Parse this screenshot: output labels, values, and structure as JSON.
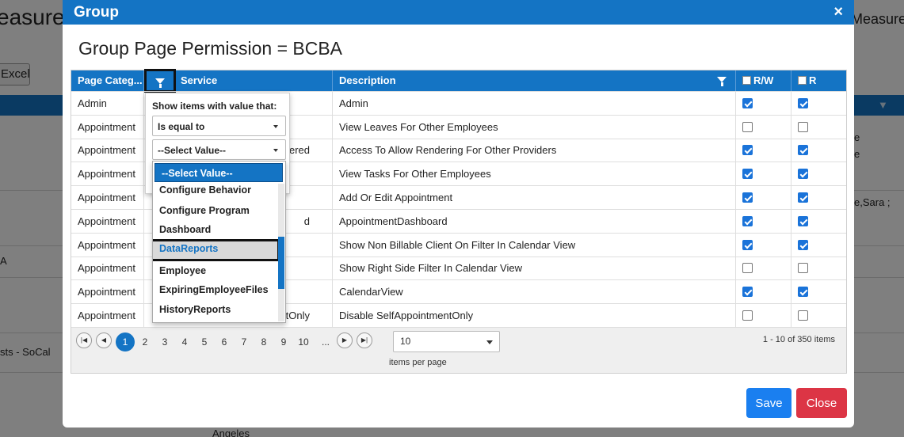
{
  "background": {
    "title_left": "easure",
    "title_right": "Measure",
    "excel_button": "Excel",
    "texts": [
      "A",
      "sts - SoCal",
      "e",
      "e",
      "e,Sara ;",
      "Angeles"
    ]
  },
  "modal": {
    "title": "Group",
    "close_icon": "×",
    "heading": "Group Page Permission = BCBA",
    "save_label": "Save",
    "close_label": "Close"
  },
  "grid": {
    "columns": {
      "category": "Page Categ...",
      "service": "Service",
      "description": "Description",
      "rw": "R/W",
      "r": "R"
    },
    "rows": [
      {
        "category": "Admin",
        "service": "",
        "description": "Admin",
        "rw": true,
        "r": true
      },
      {
        "category": "Appointment",
        "service": "",
        "description": "View Leaves For Other Employees",
        "rw": false,
        "r": false
      },
      {
        "category": "Appointment",
        "service": "ered",
        "description": "Access To Allow Rendering For Other Providers",
        "rw": true,
        "r": true
      },
      {
        "category": "Appointment",
        "service": "",
        "description": "View Tasks For Other Employees",
        "rw": true,
        "r": true
      },
      {
        "category": "Appointment",
        "service": "",
        "description": "Add Or Edit Appointment",
        "rw": true,
        "r": true
      },
      {
        "category": "Appointment",
        "service": "d",
        "description": "AppointmentDashboard",
        "rw": true,
        "r": true
      },
      {
        "category": "Appointment",
        "service": "",
        "description": "Show Non Billable Client On Filter In Calendar View",
        "rw": true,
        "r": true
      },
      {
        "category": "Appointment",
        "service": "",
        "description": "Show Right Side Filter In Calendar View",
        "rw": false,
        "r": false
      },
      {
        "category": "Appointment",
        "service": "",
        "description": "CalendarView",
        "rw": true,
        "r": true
      },
      {
        "category": "Appointment",
        "service": "ntOnly",
        "description": "Disable SelfAppointmentOnly",
        "rw": false,
        "r": false
      }
    ]
  },
  "pager": {
    "pages": [
      "1",
      "2",
      "3",
      "4",
      "5",
      "6",
      "7",
      "8",
      "9",
      "10",
      "..."
    ],
    "current_page": "1",
    "page_size": "10",
    "items_per_page_label": "items per page",
    "info": "1 - 10 of 350 items"
  },
  "filter_popup": {
    "label": "Show items with value that:",
    "operator": "Is equal to",
    "value": "--Select Value--"
  },
  "value_dropdown": {
    "items": [
      "--Select Value--",
      "Configure Behavior",
      "Configure Program",
      "Dashboard",
      "DataReports",
      "Employee",
      "ExpiringEmployeeFiles",
      "HistoryReports"
    ],
    "selected": "--Select Value--",
    "highlighted": "DataReports"
  },
  "colors": {
    "header_blue": "#1474c4",
    "save": "#1a7ff0",
    "close": "#dc3545"
  }
}
